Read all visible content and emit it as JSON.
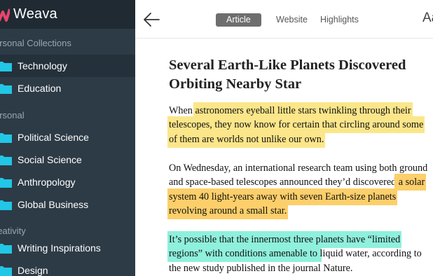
{
  "app": {
    "name": "Weava"
  },
  "colors": {
    "sidebar_bg": "#2d3b46",
    "folder": "#22c6e6",
    "highlight_yellow": "#fbe68a",
    "highlight_orange": "#fccf6a",
    "highlight_teal": "#8ff0dc"
  },
  "sidebar": {
    "sections": [
      {
        "label": "ersonal Collections",
        "items": [
          {
            "label": "Technology",
            "icon": "folder-icon",
            "active": true
          },
          {
            "label": "Education",
            "icon": "folder-icon"
          }
        ]
      },
      {
        "label": "ersonal",
        "items": [
          {
            "label": "Political Science",
            "icon": "folder-icon"
          },
          {
            "label": "Social Science",
            "icon": "folder-icon"
          },
          {
            "label": "Anthropology",
            "icon": "folder-icon"
          },
          {
            "label": "Global Business",
            "icon": "folder-icon"
          }
        ]
      },
      {
        "label": "reativity",
        "items": [
          {
            "label": "Writing Inspirations",
            "icon": "folder-icon"
          },
          {
            "label": "Design",
            "icon": "folder-icon"
          }
        ]
      }
    ]
  },
  "toolbar": {
    "back_icon": "arrow-left-icon",
    "tabs": [
      {
        "label": "Article",
        "active": true
      },
      {
        "label": "Website"
      },
      {
        "label": "Highlights"
      }
    ],
    "font_label": "Aa"
  },
  "article": {
    "title": "Several Earth-Like Planets Discovered Orbiting Nearby Star",
    "p1": {
      "before": "When ",
      "highlight": "astronomers eyeball little stars twinkling through their telescopes, they now know for certain that circling around some of them are worlds not unlike our own.",
      "after": ""
    },
    "p2": {
      "before": "On Wednesday, an international research team using both ground and space-based telescopes announced they’d discovered",
      "highlight": " a solar system 40 light-years away with seven Earth-size planets revolving around a small star.",
      "after": ""
    },
    "p3": {
      "before": "",
      "highlight": "It’s possible that the innermost three planets have “limited regions” with conditions amenable to ",
      "after": "liquid water, according to the new study published in the journal Nature."
    }
  }
}
